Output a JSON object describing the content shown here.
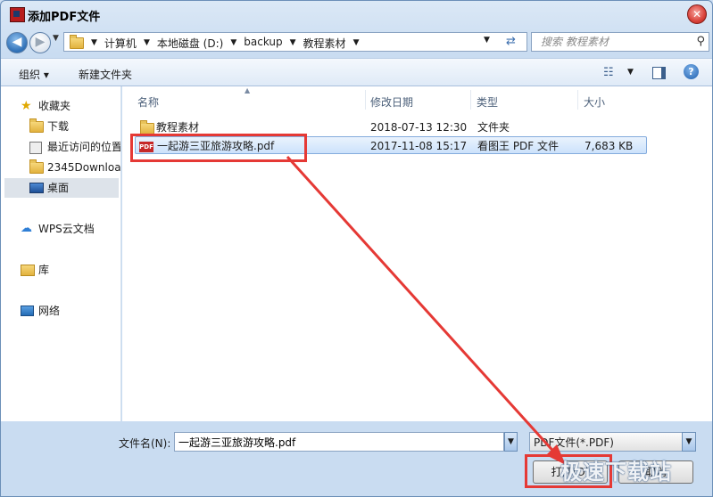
{
  "window": {
    "title": "添加PDF文件",
    "close_label": "✕"
  },
  "nav": {
    "back_label": "◀",
    "forward_label": "▶",
    "breadcrumbs": [
      "计算机",
      "本地磁盘 (D:)",
      "backup",
      "教程素材"
    ],
    "search_placeholder": "搜索 教程素材"
  },
  "toolbar": {
    "organize": "组织 ▾",
    "new_folder": "新建文件夹"
  },
  "sidebar": {
    "favorites": "收藏夹",
    "items": [
      "下载",
      "最近访问的位置",
      "2345Downloads",
      "桌面"
    ],
    "wps_cloud": "WPS云文档",
    "library": "库",
    "network": "网络"
  },
  "columns": {
    "name": "名称",
    "modified": "修改日期",
    "type": "类型",
    "size": "大小"
  },
  "files": [
    {
      "name": "教程素材",
      "modified": "2018-07-13 12:30",
      "type": "文件夹",
      "size": "",
      "icon": "folder-icon"
    },
    {
      "name": "一起游三亚旅游攻略.pdf",
      "modified": "2017-11-08 15:17",
      "type": "看图王 PDF 文件",
      "size": "7,683 KB",
      "icon": "pdf-icon"
    }
  ],
  "bottom": {
    "filename_label": "文件名(N):",
    "filename_value": "一起游三亚旅游攻略.pdf",
    "filetype": "PDF文件(*.PDF)",
    "open_button": "打开(O)",
    "cancel_button": "取消"
  },
  "watermark": "极速下载站",
  "colors": {
    "highlight": "#e53935",
    "selection": "#cce2fb"
  }
}
